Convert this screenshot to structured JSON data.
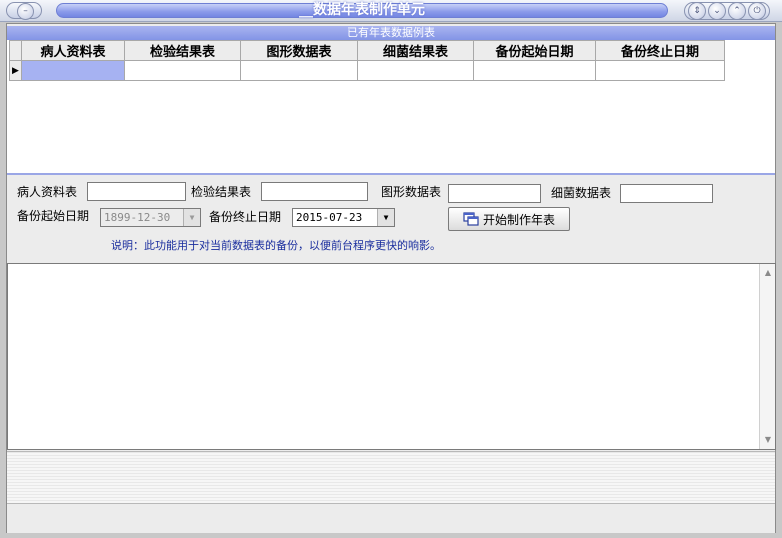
{
  "window": {
    "title": "__数据年表制作单元"
  },
  "grid": {
    "caption": "已有年表数据例表",
    "columns": [
      "病人资料表",
      "检验结果表",
      "图形数据表",
      "细菌结果表",
      "备份起始日期",
      "备份终止日期"
    ]
  },
  "form": {
    "patient_label": "病人资料表",
    "lab_label": "检验结果表",
    "graph_label": "图形数据表",
    "bacteria_label": "细菌数据表",
    "start_date_label": "备份起始日期",
    "start_date_value": "1899-12-30",
    "end_date_label": "备份终止日期",
    "end_date_value": "2015-07-23",
    "start_button_label": "开始制作年表",
    "note": "说明：此功能用于对当前数据表的备份，以便前台程序更快的响影。"
  }
}
